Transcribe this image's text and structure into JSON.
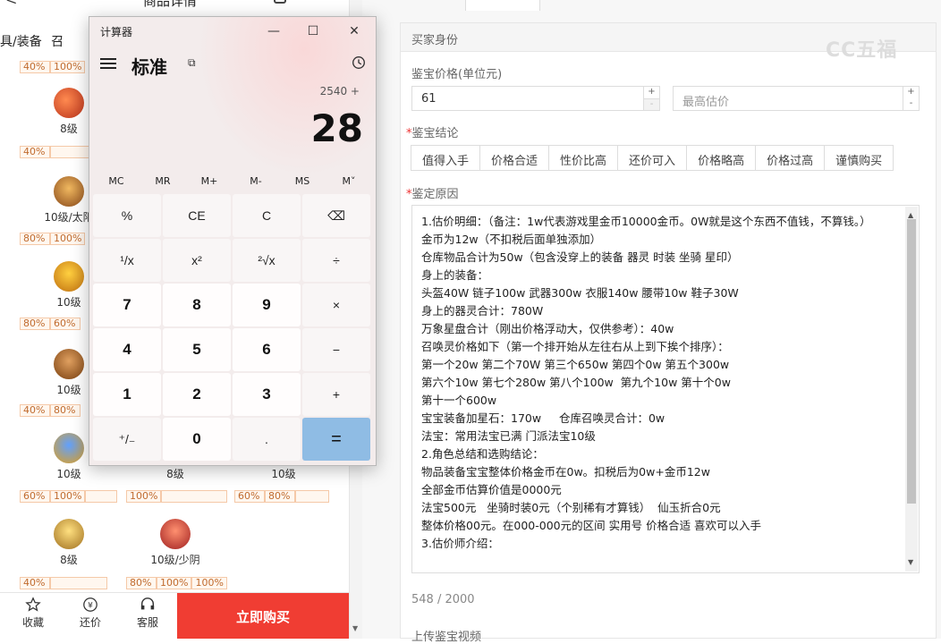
{
  "left": {
    "topbar": {
      "title": "商品详情"
    },
    "categories": [
      "具/装备",
      "召"
    ],
    "items": [
      {
        "label": "8级",
        "pcts": [
          "40%"
        ]
      },
      {
        "label": "10级/太阳",
        "pcts": [
          "80%",
          "100%"
        ]
      },
      {
        "label": "10级",
        "pcts": [
          "80%",
          "60%"
        ]
      },
      {
        "label": "10级",
        "pcts": [
          "40%",
          "80%"
        ]
      },
      {
        "label": "10级",
        "pcts": [
          "60%",
          "100%"
        ]
      },
      {
        "label": "8级",
        "pcts": [
          "100%"
        ]
      },
      {
        "label": "10级",
        "pcts": [
          "60%",
          "80%"
        ]
      },
      {
        "label": "8级",
        "pcts": [
          "40%"
        ]
      },
      {
        "label": "10级/少阴",
        "pcts": [
          "80%",
          "100%",
          "100%"
        ]
      }
    ],
    "top_pct": [
      "40%",
      "100%"
    ],
    "bottom": {
      "fav": "收藏",
      "bargain": "还价",
      "service": "客服",
      "buy": "立即购买"
    }
  },
  "right": {
    "section_title": "买家身份",
    "watermark": "CC五福",
    "price_label": "鉴宝价格(单位元)",
    "price_value": "61",
    "max_placeholder": "最高估价",
    "conclusion_label": "鉴宝结论",
    "options": [
      "值得入手",
      "价格合适",
      "性价比高",
      "还价可入",
      "价格略高",
      "价格过高",
      "谨慎购买"
    ],
    "reason_label": "鉴定原因",
    "reason_lines": [
      "1.估价明细：（备注：1w代表游戏里金币10000金币。0W就是这个东西不值钱，不算钱。）",
      "金币为12w（不扣税后面单独添加）",
      "仓库物品合计为50w（包含没穿上的装备 器灵 时装 坐骑 星印）",
      "身上的装备：",
      "头盔40W 链子100w 武器300w 衣服140w 腰带10w 鞋子30W",
      "身上的器灵合计：780W",
      "万象星盘合计（刚出价格浮动大，仅供参考）：40w",
      "召唤灵价格如下（第一个排开始从左往右从上到下挨个排序）：",
      "第一个20w 第二个70W 第三个650w 第四个0w 第五个300w",
      "第六个10w 第七个280w 第八个100w  第九个10w 第十个0w",
      "第十一个600w",
      "宝宝装备加星石：170w     仓库召唤灵合计：0w",
      "法宝：常用法宝已满 门派法宝10级",
      "2.角色总结和选购结论：",
      "物品装备宝宝整体价格金币在0w。扣税后为0w+金币12w",
      "全部金币估算价值是0000元",
      "法宝500元   坐骑时装0元（个别稀有才算钱）  仙玉折合0元",
      "整体价格00元。在000-000元的区间 实用号 价格合适 喜欢可以入手",
      "3.估价师介绍："
    ],
    "counter": "548 / 2000",
    "upload_label": "上传鉴宝视频"
  },
  "calc": {
    "window_title": "计算器",
    "mode": "标准",
    "expression": "2540 +",
    "display": "28",
    "memory": [
      "MC",
      "MR",
      "M+",
      "M-",
      "MS",
      "M˅"
    ],
    "keys": [
      "%",
      "CE",
      "C",
      "⌫",
      "¹/x",
      "x²",
      "²√x",
      "÷",
      "7",
      "8",
      "9",
      "×",
      "4",
      "5",
      "6",
      "−",
      "1",
      "2",
      "3",
      "+",
      "⁺/₋",
      "0",
      ".",
      "="
    ]
  }
}
